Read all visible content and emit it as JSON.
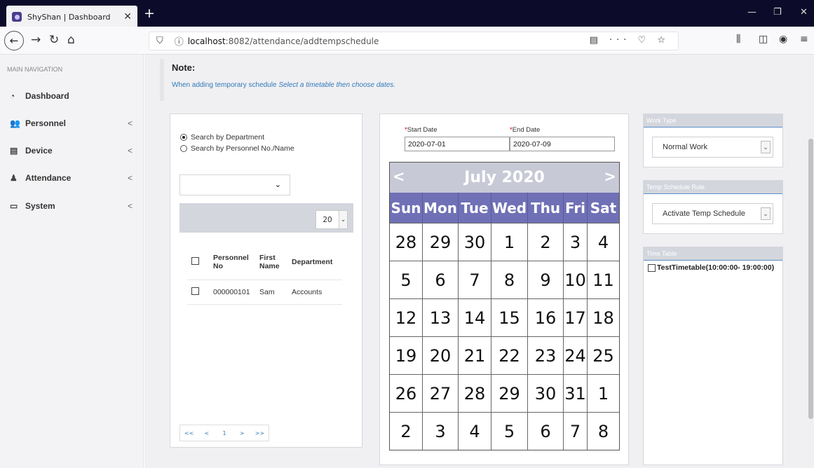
{
  "browser": {
    "tab_title": "ShyShan | Dashboard",
    "tab_close": "✕",
    "new_tab": "+",
    "url_host": "localhost",
    "url_path": ":8082/attendance/addtempschedule"
  },
  "sidebar": {
    "heading": "MAIN NAVIGATION",
    "items": [
      {
        "label": "Dashboard",
        "icon": "dashboard-icon"
      },
      {
        "label": "Personnel",
        "icon": "users-icon"
      },
      {
        "label": "Device",
        "icon": "device-icon"
      },
      {
        "label": "Attendance",
        "icon": "attendance-icon"
      },
      {
        "label": "System",
        "icon": "monitor-icon"
      }
    ],
    "chevron": "<"
  },
  "note": {
    "title": "Note:",
    "text_prefix": "When adding temporary schedule ",
    "text_italic": "Select a timetable then choose dates."
  },
  "search": {
    "by_department": "Search by Department",
    "by_personnel": "Search by Personnel No./Name"
  },
  "grid": {
    "page_size": "20",
    "headers": [
      "Personnel No",
      "First Name",
      "Department"
    ],
    "rows": [
      {
        "personnel_no": "000000101",
        "first_name": "Sam",
        "department": "Accounts"
      }
    ],
    "pager": [
      "<<",
      "<",
      "1",
      ">",
      ">>"
    ]
  },
  "dates": {
    "start_label": "Start Date",
    "start_value": "2020-07-01",
    "end_label": "End Date",
    "end_value": "2020-07-09",
    "required_mark": "*"
  },
  "calendar": {
    "title": "July 2020",
    "prev": "<",
    "next": ">",
    "days_of_week": [
      "Sun",
      "Mon",
      "Tue",
      "Wed",
      "Thu",
      "Fri",
      "Sat"
    ],
    "weeks": [
      [
        "28",
        "29",
        "30",
        "1",
        "2",
        "3",
        "4"
      ],
      [
        "5",
        "6",
        "7",
        "8",
        "9",
        "10",
        "11"
      ],
      [
        "12",
        "13",
        "14",
        "15",
        "16",
        "17",
        "18"
      ],
      [
        "19",
        "20",
        "21",
        "22",
        "23",
        "24",
        "25"
      ],
      [
        "26",
        "27",
        "28",
        "29",
        "30",
        "31",
        "1"
      ],
      [
        "2",
        "3",
        "4",
        "5",
        "6",
        "7",
        "8"
      ]
    ]
  },
  "work_type": {
    "heading": "Work Type",
    "value": "Normal Work"
  },
  "temp_rule": {
    "heading": "Temp Schedule Rule",
    "value": "Activate Temp Schedule"
  },
  "time_table": {
    "heading": "Time Table",
    "item": "TestTimetable(10:00:00- 19:00:00)"
  },
  "colors": {
    "calendar_dow_bg": "#7070b6",
    "calendar_head_bg": "#c7c9d6",
    "link_blue": "#337ab7",
    "required_red": "#cc0000"
  }
}
